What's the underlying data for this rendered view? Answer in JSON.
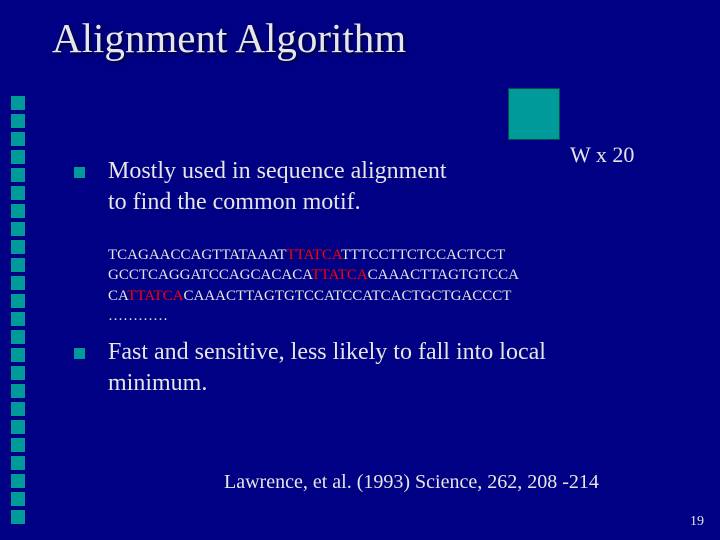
{
  "title": "Alignment Algorithm",
  "w_label": "W x 20",
  "bullet1": {
    "line1": "Mostly used in sequence alignment",
    "line2": "to find the common motif."
  },
  "seq": {
    "l1a": "TCAGAACCAGTTATAAAT",
    "l1m": "TTATCA",
    "l1b": "TTTCCTTCTCCACTCCT",
    "l2a": "GCCTCAGGATCCAGCACACA",
    "l2m": "TTATCA",
    "l2b": "CAAACTTAGTGTCCA",
    "l3a": "CA",
    "l3m": "TTATCA",
    "l3b": "CAAACTTAGTGTCCATCCATCACTGCTGACCCT",
    "l4": "…………"
  },
  "bullet2": {
    "line1": "Fast and sensitive, less likely to fall into local",
    "line2": "minimum."
  },
  "citation": "Lawrence, et al. (1993) Science, 262, 208 -214",
  "pagenum": "19"
}
